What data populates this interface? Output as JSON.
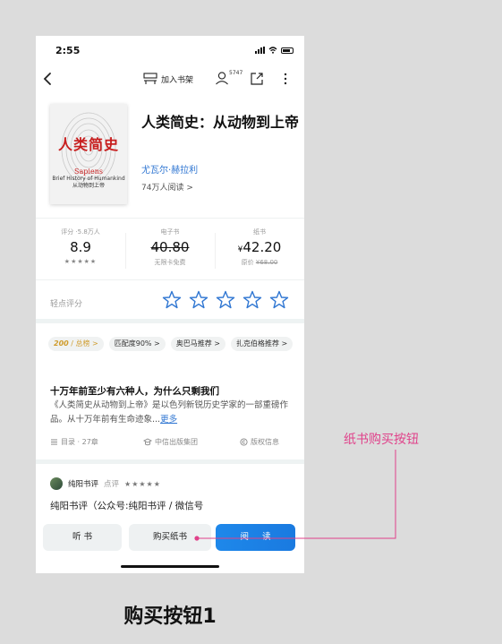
{
  "status_bar": {
    "time": "2:55"
  },
  "nav": {
    "add_shelf": "加入书架",
    "listen_count": "5747"
  },
  "book": {
    "cover_title": "人类简史",
    "cover_subtitle_line1": "Sapiens",
    "cover_subtitle_line2": "Brief History of Humankind",
    "cover_subtitle_line3": "从动物到上帝",
    "title": "人类简史：从动物到上帝",
    "author": "尤瓦尔·赫拉利",
    "readers": "74万人阅读 >"
  },
  "stats": {
    "rating": {
      "label": "评分 ·5.8万人",
      "value": "8.9",
      "stars": "★★★★★"
    },
    "ebook": {
      "label": "电子书",
      "price": "40.80",
      "note": "无限卡免费"
    },
    "paper": {
      "label": "纸书",
      "currency": "¥",
      "price": "42.20",
      "original_label": "原价",
      "original_price": "¥68.00"
    }
  },
  "quick_rate": {
    "label": "轻点评分",
    "max_stars": 5
  },
  "tags": [
    {
      "rank_num": "200",
      "text": "/ 总榜 >",
      "type": "rank"
    },
    {
      "text": "匹配度90% >",
      "type": "normal"
    },
    {
      "text": "奥巴马推荐 >",
      "type": "normal"
    },
    {
      "text": "扎克伯格推荐 >",
      "type": "normal"
    }
  ],
  "intro": {
    "title": "十万年前至少有六种人，为什么只剩我们",
    "text": "《人类简史从动物到上帝》是以色列新锐历史学家的一部重磅作品。从十万年前有生命迹象...",
    "more": "更多"
  },
  "meta": {
    "toc": "目录 · 27章",
    "publisher": "中信出版集团",
    "copyright": "版权信息"
  },
  "review": {
    "name": "纯阳书评",
    "tag": "点评",
    "stars": "★★★★★",
    "text": "纯阳书评（公众号:纯阳书评 / 微信号"
  },
  "bottom_bar": {
    "listen": "听 书",
    "buy_paper": "购买纸书",
    "read": "阅 读"
  },
  "annotation": {
    "label": "纸书购买按钮",
    "color": "#e0418a"
  },
  "caption": "购买按钮1",
  "colors": {
    "link_blue": "#2f76d2",
    "read_button": "#1a7ae0",
    "cover_red": "#c81e1e",
    "rank_gold": "#cf9c2c"
  }
}
